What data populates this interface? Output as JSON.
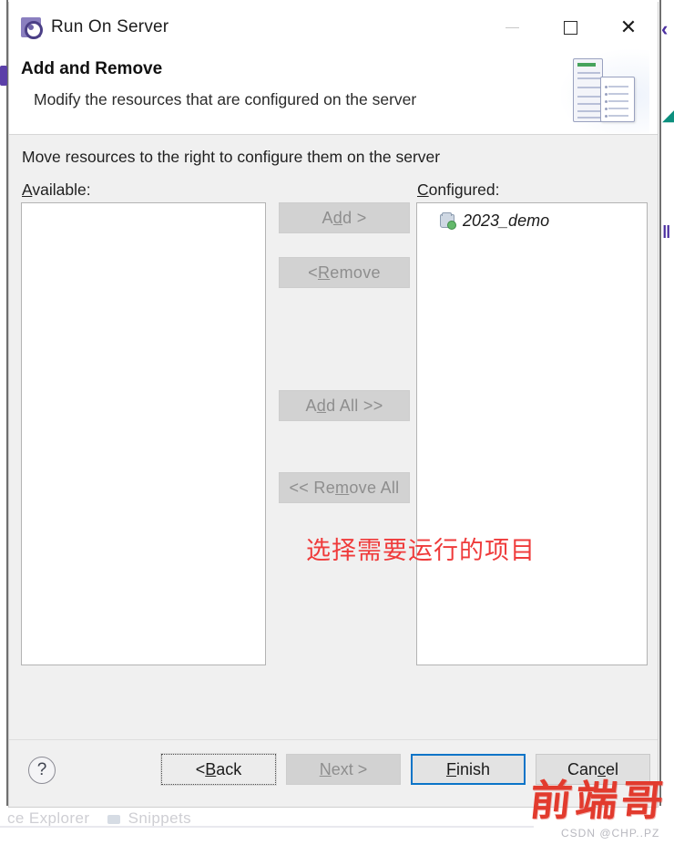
{
  "window": {
    "title": "Run On Server",
    "icon": "run-on-server-icon",
    "controls": {
      "minimize": "minimize-icon",
      "maximize": "maximize-icon",
      "close": "close-icon"
    }
  },
  "banner": {
    "title": "Add and Remove",
    "subtitle": "Modify the resources that are configured on the server",
    "art": "server-and-document-icon"
  },
  "main": {
    "intro": "Move resources to the right to configure them on the server",
    "available": {
      "label_prefix": "A",
      "label_rest": "vailable:",
      "items": []
    },
    "configured": {
      "label_prefix": "C",
      "label_rest": "onfigured:",
      "items": [
        {
          "name": "2023_demo",
          "icon": "project-module-icon"
        }
      ]
    },
    "transfer_buttons": [
      {
        "name": "add",
        "pre": "A",
        "mn": "d",
        "post": "d >",
        "enabled": false
      },
      {
        "name": "remove",
        "pre": "< ",
        "mn": "R",
        "post": "emove",
        "enabled": false
      },
      {
        "name": "add-all",
        "pre": "A",
        "mn": "d",
        "post": "d All >>",
        "enabled": false
      },
      {
        "name": "remove-all",
        "pre": "<< Re",
        "mn": "m",
        "post": "ove All",
        "enabled": false
      }
    ]
  },
  "annotation": {
    "text": "选择需要运行的项目",
    "color": "#ef3b3b"
  },
  "footer": {
    "help": "?",
    "buttons": [
      {
        "name": "back",
        "pre": "< ",
        "mn": "B",
        "post": "ack",
        "state": "focused"
      },
      {
        "name": "next",
        "pre": "",
        "mn": "N",
        "post": "ext >",
        "state": "disabled"
      },
      {
        "name": "finish",
        "pre": "",
        "mn": "F",
        "post": "inish",
        "state": "default"
      },
      {
        "name": "cancel",
        "pre": "Can",
        "mn": "c",
        "post": "el",
        "state": "normal"
      }
    ]
  },
  "watermark": {
    "text": "前端哥",
    "credit": "CSDN @CHP..PZ"
  },
  "background": {
    "bottom_tabs_left": "ce Explorer",
    "bottom_tabs_right": "Snippets"
  },
  "colors": {
    "accent_blue": "#0a74c8",
    "annotation_red": "#ef3b3b",
    "watermark_red": "#e23b2e",
    "dialog_bg": "#f0f0f0",
    "disabled_text": "#8e8e8e"
  }
}
